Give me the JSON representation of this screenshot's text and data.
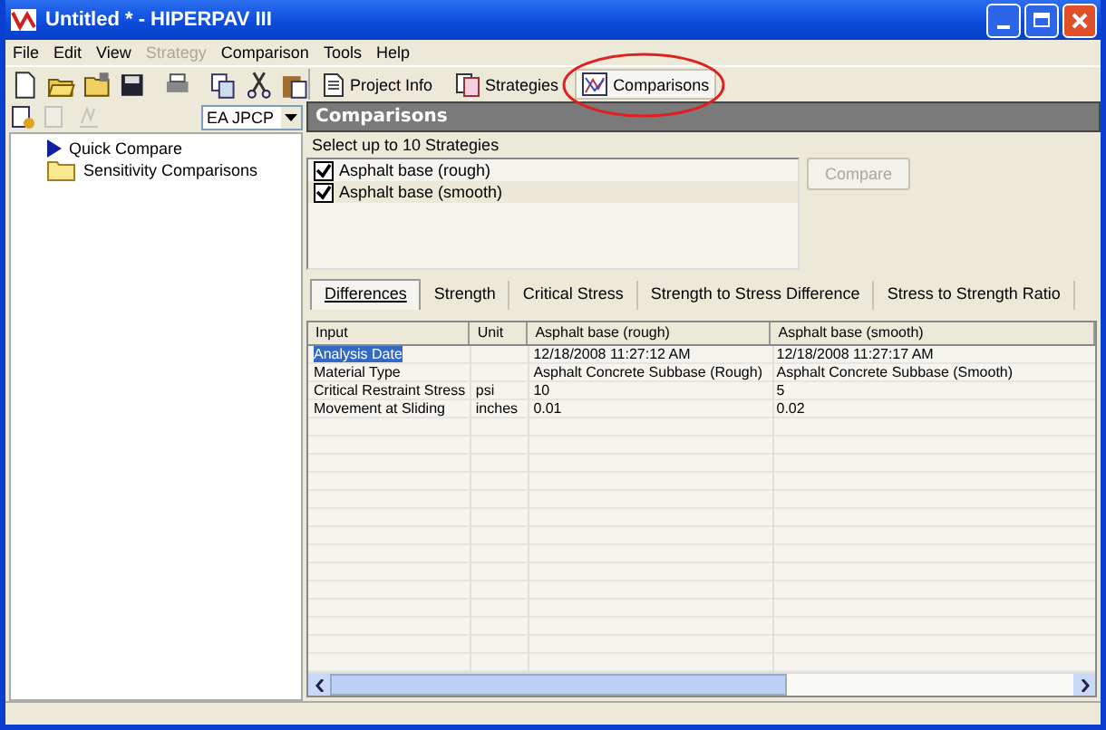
{
  "window": {
    "title": "Untitled * - HIPERPAV III"
  },
  "menu": [
    {
      "label": "File",
      "disabled": false
    },
    {
      "label": "Edit",
      "disabled": false
    },
    {
      "label": "View",
      "disabled": false
    },
    {
      "label": "Strategy",
      "disabled": true
    },
    {
      "label": "Comparison",
      "disabled": false
    },
    {
      "label": "Tools",
      "disabled": false
    },
    {
      "label": "Help",
      "disabled": false
    }
  ],
  "view_tabs": [
    {
      "label": "Project Info",
      "selected": false,
      "kind": "doc"
    },
    {
      "label": "Strategies",
      "selected": false,
      "kind": "strategies"
    },
    {
      "label": "Comparisons",
      "selected": true,
      "kind": "chart"
    }
  ],
  "combo": {
    "value": "EA JPCP"
  },
  "tree": [
    {
      "label": "Quick Compare",
      "kind": "arrow"
    },
    {
      "label": "Sensitivity Comparisons",
      "kind": "folder"
    }
  ],
  "panel_title": "Comparisons",
  "select_label": "Select up to 10 Strategies",
  "strategies": [
    {
      "label": "Asphalt base (rough)",
      "checked": true,
      "selected": false
    },
    {
      "label": "Asphalt base (smooth)",
      "checked": true,
      "selected": true
    }
  ],
  "compare_button": {
    "label": "Compare",
    "disabled": true
  },
  "result_tabs": [
    {
      "label": "Differences",
      "selected": true
    },
    {
      "label": "Strength",
      "selected": false
    },
    {
      "label": "Critical Stress",
      "selected": false
    },
    {
      "label": "Strength to Stress Difference",
      "selected": false
    },
    {
      "label": "Stress to Strength Ratio",
      "selected": false
    }
  ],
  "table": {
    "columns": [
      "Input",
      "Unit",
      "Asphalt base (rough)",
      "Asphalt base (smooth)"
    ],
    "rows": [
      {
        "cells": [
          "Analysis Date",
          "",
          "12/18/2008 11:27:12 AM",
          "12/18/2008 11:27:17 AM"
        ],
        "selected": true
      },
      {
        "cells": [
          "Material Type",
          "",
          "Asphalt Concrete Subbase (Rough)",
          "Asphalt Concrete Subbase (Smooth)"
        ],
        "selected": false
      },
      {
        "cells": [
          "Critical Restraint Stress",
          "psi",
          "10",
          "5"
        ],
        "selected": false
      },
      {
        "cells": [
          "Movement at Sliding",
          "inches",
          "0.01",
          "0.02"
        ],
        "selected": false
      }
    ]
  }
}
